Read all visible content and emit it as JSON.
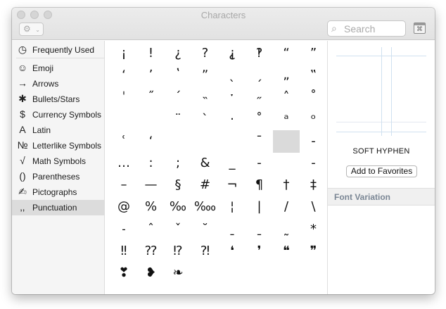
{
  "window": {
    "title": "Characters"
  },
  "toolbar": {
    "gear_icon": "gear-icon",
    "search_placeholder": "Search",
    "keyboard_icon": "character-viewer-icon"
  },
  "sidebar": {
    "items": [
      {
        "label": "Frequently Used",
        "icon": "clock-icon",
        "glyph": "◷"
      },
      {
        "label": "Emoji",
        "icon": "smiley-icon",
        "glyph": "☺"
      },
      {
        "label": "Arrows",
        "icon": "arrow-icon",
        "glyph": "→"
      },
      {
        "label": "Bullets/Stars",
        "icon": "asterisk-icon",
        "glyph": "✱"
      },
      {
        "label": "Currency Symbols",
        "icon": "dollar-icon",
        "glyph": "$"
      },
      {
        "label": "Latin",
        "icon": "latin-a-icon",
        "glyph": "A"
      },
      {
        "label": "Letterlike Symbols",
        "icon": "numero-icon",
        "glyph": "№"
      },
      {
        "label": "Math Symbols",
        "icon": "square-root-icon",
        "glyph": "√"
      },
      {
        "label": "Parentheses",
        "icon": "parentheses-icon",
        "glyph": "()"
      },
      {
        "label": "Pictographs",
        "icon": "hand-writing-icon",
        "glyph": "✍"
      },
      {
        "label": "Punctuation",
        "icon": "punctuation-icon",
        "glyph": "‚,"
      }
    ],
    "selected_index": 10
  },
  "characters": [
    [
      "¡",
      "!",
      "¿",
      "?",
      "⸘",
      "‽",
      "“",
      "”"
    ],
    [
      "ʻ",
      "ʼ",
      "ʽ",
      "ˮ",
      "ˎ",
      "ˏ",
      "„",
      "‟"
    ],
    [
      "ˈ",
      "˝",
      "ˊ",
      "˵",
      "ˑ",
      "˶",
      "˄",
      "˚"
    ],
    [
      "",
      "",
      "¨",
      "ˋ",
      "·",
      "˚",
      "ᵃ",
      "ᵒ"
    ],
    [
      "ʿ",
      "ʻ",
      "",
      "",
      "",
      "¯",
      "­",
      "‐"
    ],
    [
      "…",
      ":",
      ";",
      "&",
      "_",
      "‐",
      "­",
      "‑"
    ],
    [
      "–",
      "—",
      "§",
      "#",
      "¬",
      "¶",
      "†",
      "‡"
    ],
    [
      "@",
      "%",
      "‰",
      "‱",
      "¦",
      "|",
      "/",
      "\\"
    ],
    [
      "˗",
      "ˆ",
      "ˇ",
      "˘",
      "ˍ",
      "ˍ",
      "˷",
      "*"
    ],
    [
      "‼",
      "⁇",
      "⁉",
      "⁈",
      "❛",
      "❜",
      "❝",
      "❞"
    ],
    [
      "❣",
      "❥",
      "❧",
      "",
      "",
      "",
      "",
      ""
    ]
  ],
  "selected_cell": {
    "row": 4,
    "col": 6
  },
  "detail": {
    "char_name": "SOFT HYPHEN",
    "add_favorites_label": "Add to Favorites",
    "font_variation_label": "Font Variation"
  }
}
